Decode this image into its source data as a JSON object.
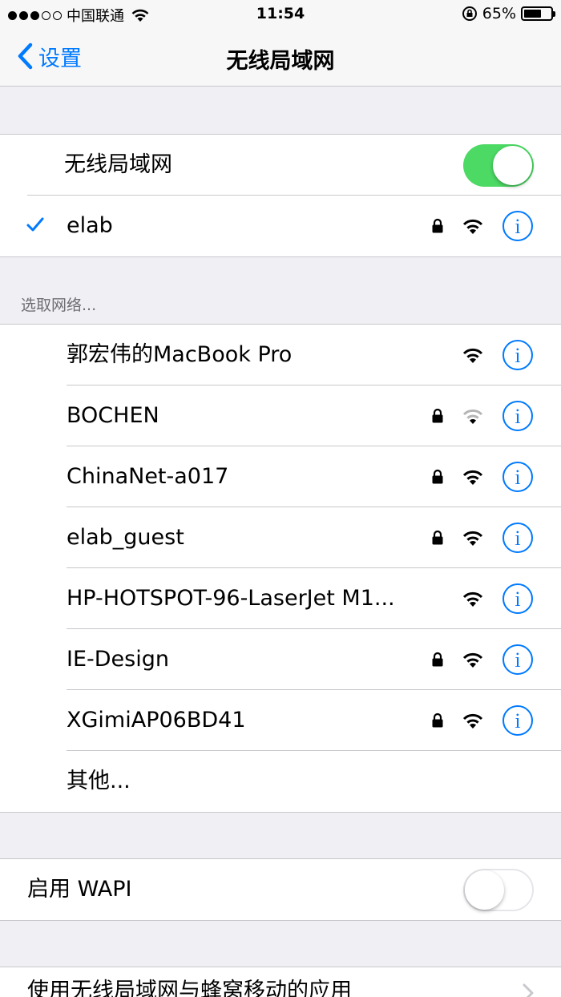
{
  "status_bar": {
    "carrier": "中国联通",
    "time": "11:54",
    "battery": "65%",
    "battery_level": 0.65,
    "signal_bars_filled": 3,
    "signal_bars_total": 5
  },
  "nav": {
    "back_label": "设置",
    "title": "无线局域网"
  },
  "wifi_toggle": {
    "label": "无线局域网",
    "on": true
  },
  "connected": {
    "name": "elab",
    "locked": true,
    "signal": "full"
  },
  "choose_network_header": "选取网络...",
  "networks": [
    {
      "name": "郭宏伟的MacBook Pro",
      "locked": false,
      "signal": "full"
    },
    {
      "name": "BOCHEN",
      "locked": true,
      "signal": "weak"
    },
    {
      "name": "ChinaNet-a017",
      "locked": true,
      "signal": "full"
    },
    {
      "name": "elab_guest",
      "locked": true,
      "signal": "full"
    },
    {
      "name": "HP-HOTSPOT-96-LaserJet M1...",
      "locked": false,
      "signal": "full"
    },
    {
      "name": "IE-Design",
      "locked": true,
      "signal": "full"
    },
    {
      "name": "XGimiAP06BD41",
      "locked": true,
      "signal": "full"
    }
  ],
  "other_label": "其他...",
  "wapi": {
    "label": "启用 WAPI",
    "on": false
  },
  "cellular_apps_label": "使用无线局域网与蜂窝移动的应用",
  "colors": {
    "accent": "#007aff",
    "toggle_on": "#4cd964",
    "background": "#efeff4"
  }
}
